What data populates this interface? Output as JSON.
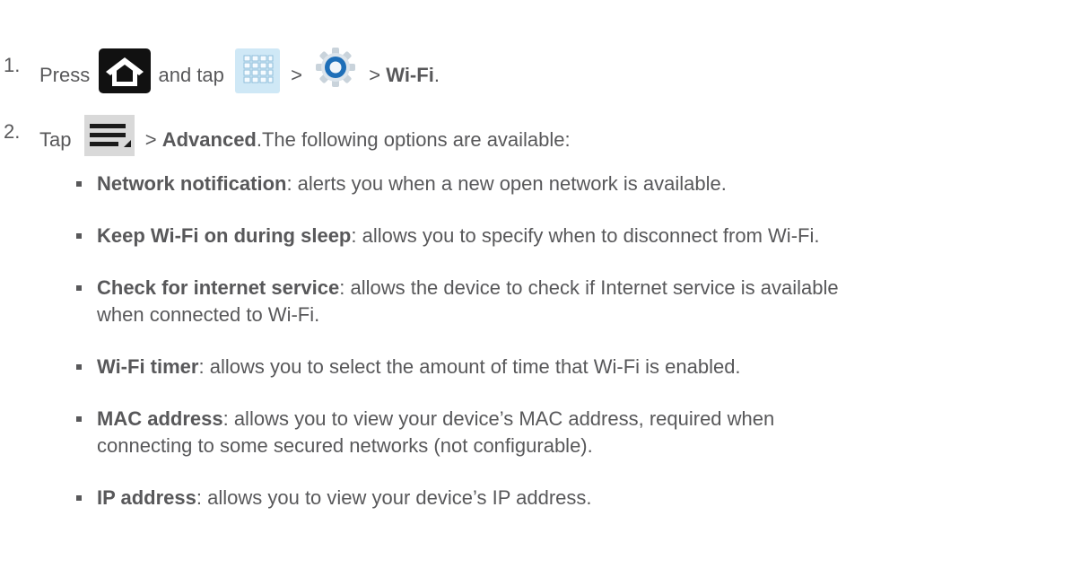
{
  "step1": {
    "number": "1.",
    "press": "Press",
    "and_tap": "and tap",
    "sep1": ">",
    "sep2": ">",
    "wifi": "Wi-Fi",
    "period": "."
  },
  "step2": {
    "number": "2.",
    "tap": "Tap",
    "sep": ">",
    "advanced": "Advanced",
    "rest": ".The following options are available:"
  },
  "options": [
    {
      "term": "Network notification",
      "line1": ": alerts you when a new open network is available.",
      "line2": ""
    },
    {
      "term": "Keep Wi-Fi on during sleep",
      "line1": ": allows you to specify when to disconnect from Wi-Fi.",
      "line2": ""
    },
    {
      "term": "Check for internet service",
      "line1": ": allows the device to check if Internet service is available",
      "line2": "when connected to Wi-Fi."
    },
    {
      "term": "Wi-Fi timer",
      "line1": ": allows you to select the amount of time that Wi-Fi is enabled.",
      "line2": ""
    },
    {
      "term": "MAC address",
      "line1": ": allows you to view your device’s MAC address, required when",
      "line2": "connecting to some secured networks (not configurable)."
    },
    {
      "term": "IP address",
      "line1": ": allows you to view your device’s IP address.",
      "line2": ""
    }
  ],
  "icons": {
    "home": "home-icon",
    "apps": "apps-grid-icon",
    "settings": "settings-gear-icon",
    "menu": "menu-icon",
    "colors": {
      "text": "#58585a",
      "home_bg": "#111111",
      "apps_bg": "#cfe8f6",
      "gear_blue": "#1f6fb8",
      "menu_bg": "#d9d9d9"
    }
  }
}
